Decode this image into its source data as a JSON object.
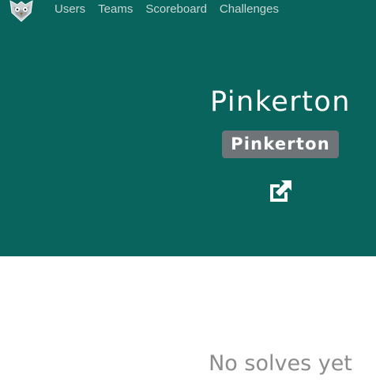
{
  "nav": {
    "logo_icon": "ctfd-owl-logo-icon",
    "items": [
      {
        "label": "Users"
      },
      {
        "label": "Teams"
      },
      {
        "label": "Scoreboard"
      },
      {
        "label": "Challenges"
      }
    ]
  },
  "team": {
    "name": "Pinkerton",
    "badge": "Pinkerton",
    "external_link_icon": "external-link-icon"
  },
  "solves": {
    "empty_message": "No solves yet"
  },
  "colors": {
    "header_bg": "#08645c",
    "badge_bg": "#6e7477",
    "nav_text": "#c9d7d6",
    "empty_text": "#8c8c8c"
  }
}
